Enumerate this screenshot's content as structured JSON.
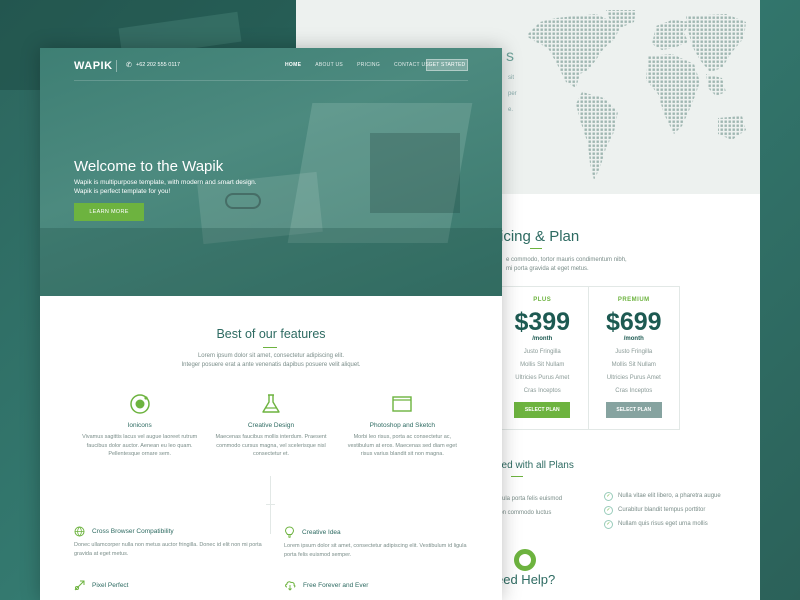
{
  "front": {
    "logo": "WAPIK",
    "phone": "+62 202 555 0117",
    "nav": [
      "HOME",
      "ABOUT US",
      "PRICING",
      "CONTACT US"
    ],
    "nav_cta": "GET STARTED",
    "hero": {
      "title": "Welcome to the Wapik",
      "subtitle": "Wapik is multipurpose template, with modern and smart design. Wapik is perfect template for you!",
      "button": "LEARN MORE"
    },
    "features_section": {
      "title": "Best of our features",
      "desc_line1": "Lorem ipsum dolor sit amet, consectetur adipiscing elit.",
      "desc_line2": "Integer posuere erat a ante venenatis dapibus posuere velit aliquet."
    },
    "features": [
      {
        "icon": "ionicons-icon",
        "name": "Ionicons",
        "text": "Vivamus sagittis lacus vel augue laoreet rutrum faucibus dolor auctor. Aenean eu leo quam. Pellentesque ornare sem."
      },
      {
        "icon": "flask-icon",
        "name": "Creative Design",
        "text": "Maecenas faucibus mollis interdum. Praesent commodo cursus magna, vel scelerisque nisl consectetur et."
      },
      {
        "icon": "layers-icon",
        "name": "Photoshop and Sketch",
        "text": "Morbi leo risus, porta ac consectetur ac, vestibulum at eros. Maecenas sed diam eget risus varius blandit sit non magna."
      }
    ],
    "feature_list": [
      {
        "icon": "globe-icon",
        "name": "Cross Browser Compatibility",
        "text": "Donec ullamcorper nulla non metus auctor fringilla. Donec id elit non mi porta gravida at eget metus."
      },
      {
        "icon": "lightbulb-icon",
        "name": "Creative Idea",
        "text": "Lorem ipsum dolor sit amet, consectetur adipiscing elit. Vestibulum id ligula porta felis euismod semper."
      },
      {
        "icon": "crosshair-icon",
        "name": "Pixel Perfect",
        "text": ""
      },
      {
        "icon": "cloud-download-icon",
        "name": "Free Forever and Ever",
        "text": ""
      }
    ]
  },
  "back": {
    "map_peek": "s",
    "map_peek_lines": [
      "sit",
      "per",
      "e."
    ],
    "pricing": {
      "title": "icing & Plan",
      "desc_line1": "e commodo, tortor mauris condimentum nibh,",
      "desc_line2": "mi porta gravida at eget metus."
    },
    "plans": [
      {
        "name": "PLUS",
        "price": "$399",
        "period": "/month",
        "features": [
          "Justo Fringilla",
          "Mollis Sit Nullam",
          "Ultricies Purus Amet",
          "Cras Inceptos"
        ],
        "button": "SELECT PLAN",
        "accent": "#6db33f"
      },
      {
        "name": "PREMIUM",
        "price": "$699",
        "period": "/month",
        "features": [
          "Justo Fringilla",
          "Mollis Sit Nullam",
          "Ultricies Purus Amet",
          "Cras Inceptos"
        ],
        "button": "SELECT PLAN",
        "accent": "#86a3a0"
      }
    ],
    "included_title": "ded with all Plans",
    "included_left": [
      "ligula porta felis euismod",
      "non commodo luctus",
      "re"
    ],
    "included_right": [
      "Nulla vitae elit libero, a pharetra augue",
      "Curabitur blandit tempus porttitor",
      "Nullam quis risus eget urna mollis"
    ],
    "need_help": "eed Help?"
  },
  "colors": {
    "primary": "#2e6b62",
    "accent": "#6db33f",
    "muted": "#7a8d89"
  }
}
